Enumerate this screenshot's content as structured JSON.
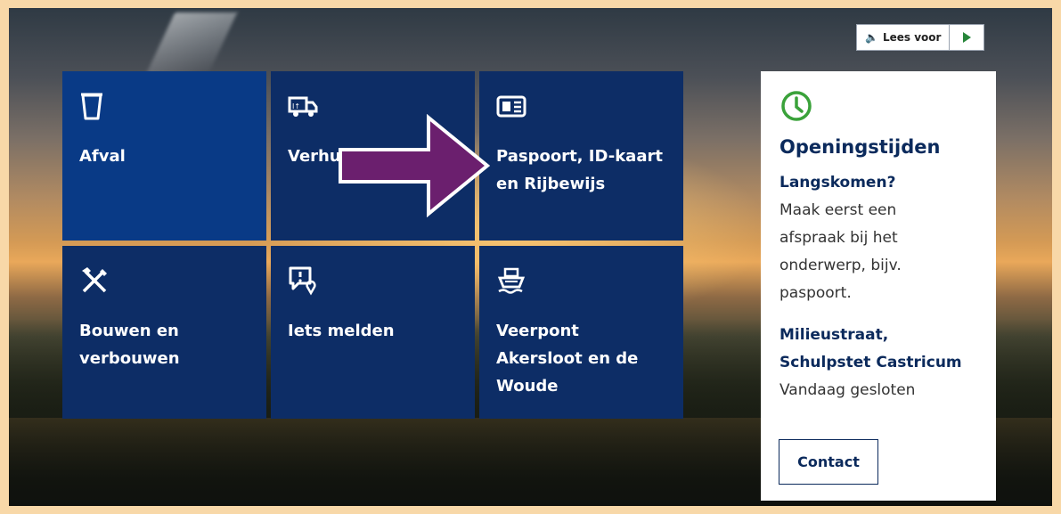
{
  "readaloud": {
    "label": "Lees voor",
    "speaker_icon": "speaker-icon",
    "play_icon": "play-icon",
    "accent": "#27863a"
  },
  "tiles": [
    {
      "label": "Afval",
      "icon": "trash-bin-icon"
    },
    {
      "label": "Verhuizen",
      "icon": "moving-truck-icon"
    },
    {
      "label": "Paspoort, ID-kaart\nen Rijbewijs",
      "icon": "id-card-icon"
    },
    {
      "label": "Bouwen en\nverbouwen",
      "icon": "tools-icon"
    },
    {
      "label": "Iets melden",
      "icon": "report-location-icon"
    },
    {
      "label": "Veerpont\nAkersloot en de\nWoude",
      "icon": "ferry-icon"
    }
  ],
  "hours": {
    "icon": "clock-icon",
    "title": "Openingstijden",
    "block1_title": "Langskomen?",
    "block1_text": "Maak eerst een\nafspraak bij het\nonderwerp, bijv.\npaspoort.",
    "block2_title": "Milieustraat,\nSchulpstet Castricum",
    "block2_text": "Vandaag gesloten",
    "contact_label": "Contact"
  },
  "colors": {
    "tile": "#0d2d66",
    "tile_first": "#093a86",
    "frame": "#f8d8a8",
    "clock_green": "#3aa23a",
    "arrow": "#6b1f6e"
  }
}
